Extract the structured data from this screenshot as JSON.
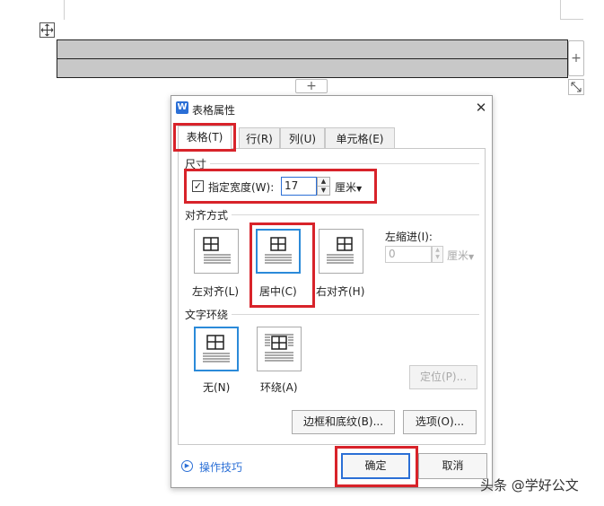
{
  "document": {
    "add_column_symbol": "+",
    "add_row_symbol": "+"
  },
  "dialog": {
    "app_icon_letter": "W",
    "title": "表格属性",
    "close_symbol": "✕",
    "tabs": [
      {
        "label": "表格(T)",
        "active": true
      },
      {
        "label": "行(R)",
        "active": false
      },
      {
        "label": "列(U)",
        "active": false
      },
      {
        "label": "单元格(E)",
        "active": false
      }
    ],
    "size": {
      "section_label": "尺寸",
      "checkbox_label": "指定宽度(W):",
      "checked": true,
      "width_value": "17",
      "unit": "厘米"
    },
    "alignment": {
      "section_label": "对齐方式",
      "options": [
        {
          "label": "左对齐(L)",
          "selected": false
        },
        {
          "label": "居中(C)",
          "selected": true
        },
        {
          "label": "右对齐(H)",
          "selected": false
        }
      ],
      "indent_label": "左缩进(I):",
      "indent_value": "0",
      "indent_unit": "厘米"
    },
    "wrapping": {
      "section_label": "文字环绕",
      "options": [
        {
          "label": "无(N)",
          "selected": true
        },
        {
          "label": "环绕(A)",
          "selected": false
        }
      ],
      "position_button": "定位(P)..."
    },
    "buttons": {
      "borders": "边框和底纹(B)...",
      "options": "选项(O)...",
      "ok": "确定",
      "cancel": "取消"
    },
    "tips_link": "操作技巧"
  },
  "watermark": "头条 @学好公文",
  "colors": {
    "accent": "#2b6fd6",
    "highlight": "#d8232a",
    "table_fill": "#c8c8c8"
  }
}
